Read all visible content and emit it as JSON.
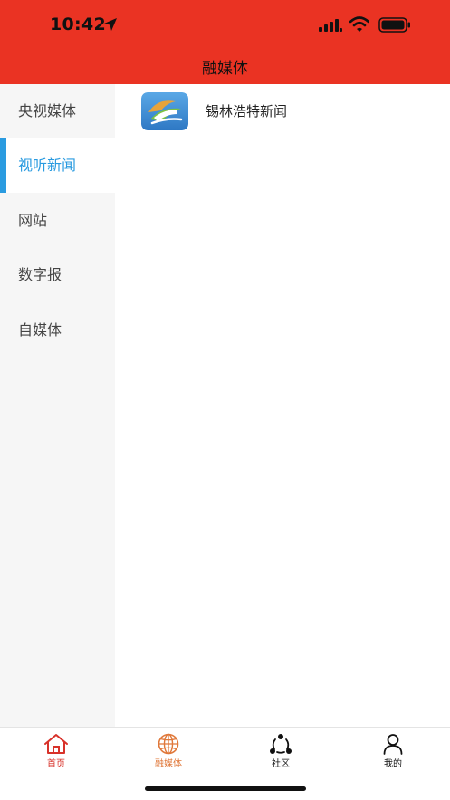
{
  "status_bar": {
    "time": "10:42"
  },
  "header": {
    "title": "融媒体"
  },
  "sidebar": {
    "items": [
      {
        "label": "央视媒体",
        "active": false
      },
      {
        "label": "视听新闻",
        "active": true
      },
      {
        "label": "网站",
        "active": false
      },
      {
        "label": "数字报",
        "active": false
      },
      {
        "label": "自媒体",
        "active": false
      }
    ]
  },
  "content": {
    "items": [
      {
        "label": "锡林浩特新闻",
        "icon": "app-logo-icon"
      }
    ]
  },
  "tabbar": {
    "tabs": [
      {
        "label": "首页",
        "icon": "home-icon",
        "color": "#D8322A"
      },
      {
        "label": "融媒体",
        "icon": "globe-icon",
        "color": "#E0783A"
      },
      {
        "label": "社区",
        "icon": "community-icon",
        "color": "#111111"
      },
      {
        "label": "我的",
        "icon": "user-icon",
        "color": "#111111"
      }
    ]
  },
  "colors": {
    "header_bg": "#EA3323",
    "active_accent": "#2A9BE0",
    "sidebar_bg": "#F6F6F6"
  }
}
